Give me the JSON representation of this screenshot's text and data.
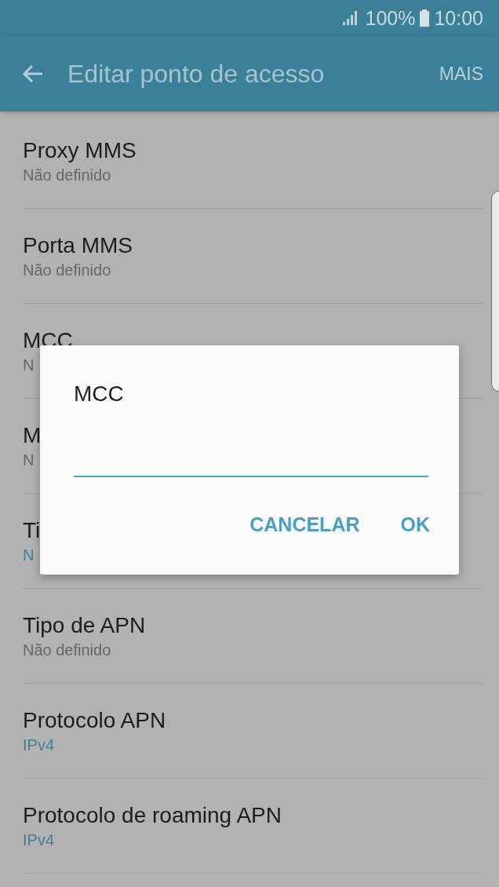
{
  "status_bar": {
    "battery": "100%",
    "time": "10:00"
  },
  "app_bar": {
    "title": "Editar ponto de acesso",
    "action": "MAIS"
  },
  "settings": [
    {
      "title": "Proxy MMS",
      "value": "Não definido",
      "accent": false
    },
    {
      "title": "Porta MMS",
      "value": "Não definido",
      "accent": false
    },
    {
      "title": "MCC",
      "value": "N",
      "accent": false
    },
    {
      "title": "M",
      "value": "N",
      "accent": false
    },
    {
      "title": "Ti",
      "value": "N",
      "accent": true
    },
    {
      "title": "Tipo de APN",
      "value": "Não definido",
      "accent": false
    },
    {
      "title": "Protocolo APN",
      "value": "IPv4",
      "accent": true
    },
    {
      "title": "Protocolo de roaming APN",
      "value": "IPv4",
      "accent": true
    }
  ],
  "dialog": {
    "title": "MCC",
    "buttons": [
      "CANCELAR",
      "OK"
    ]
  }
}
